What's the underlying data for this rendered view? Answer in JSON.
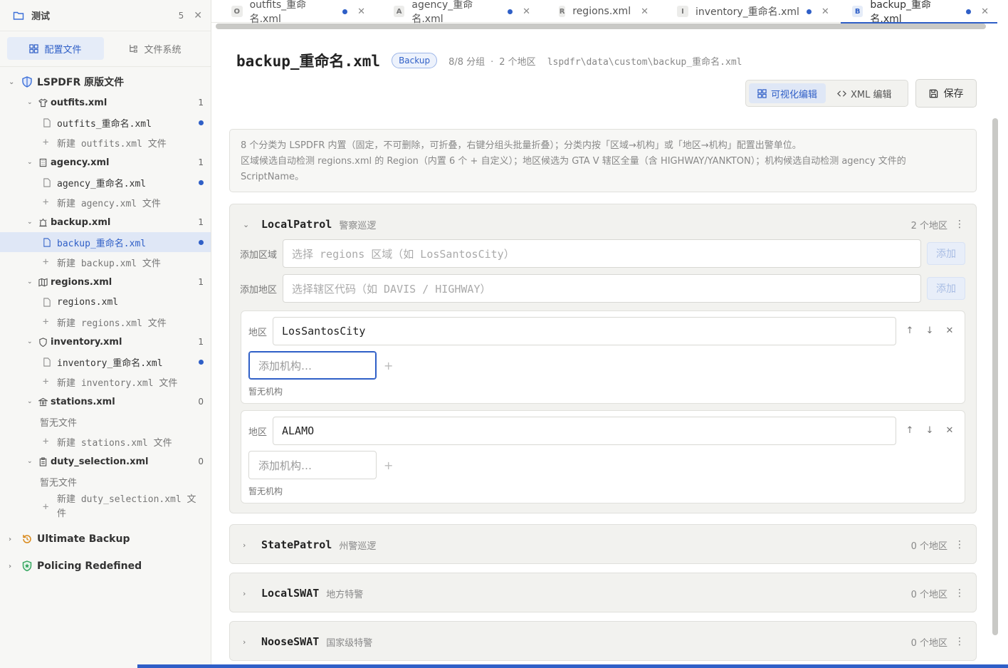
{
  "workspace": {
    "title": "测试",
    "count": "5",
    "close": "✕"
  },
  "sidebar_tabs": [
    {
      "label": "配置文件",
      "active": true
    },
    {
      "label": "文件系统",
      "active": false
    }
  ],
  "tree": {
    "roots": [
      {
        "label": "LSPDFR 原版文件",
        "icon": "shield-icon",
        "color": "#3b6fd8"
      },
      {
        "label": "Ultimate Backup",
        "icon": "backup-icon",
        "color": "#d98a1c"
      },
      {
        "label": "Policing Redefined",
        "icon": "badge-icon",
        "color": "#2fa35a"
      }
    ],
    "groups": [
      {
        "label": "outfits.xml",
        "count": "1",
        "icon": "shirt-icon",
        "file": "outfits_重命名.xml",
        "file_dot": true,
        "new": "新建 outfits.xml 文件"
      },
      {
        "label": "agency.xml",
        "count": "1",
        "icon": "building-icon",
        "file": "agency_重命名.xml",
        "file_dot": true,
        "new": "新建 agency.xml 文件"
      },
      {
        "label": "backup.xml",
        "count": "1",
        "icon": "siren-icon",
        "file": "backup_重命名.xml",
        "file_dot": true,
        "new": "新建 backup.xml 文件"
      },
      {
        "label": "regions.xml",
        "count": "1",
        "icon": "map-icon",
        "file": "regions.xml",
        "file_dot": false,
        "new": "新建 regions.xml 文件"
      },
      {
        "label": "inventory.xml",
        "count": "1",
        "icon": "shield-outline-icon",
        "file": "inventory_重命名.xml",
        "file_dot": true,
        "new": "新建 inventory.xml 文件"
      },
      {
        "label": "stations.xml",
        "count": "0",
        "icon": "station-icon",
        "empty": "暂无文件",
        "new": "新建 stations.xml 文件"
      },
      {
        "label": "duty_selection.xml",
        "count": "0",
        "icon": "clipboard-icon",
        "empty": "暂无文件",
        "new": "新建 duty_selection.xml 文件"
      }
    ]
  },
  "tabs": [
    {
      "letter": "O",
      "label": "outfits_重命名.xml",
      "dot": true
    },
    {
      "letter": "A",
      "label": "agency_重命名.xml",
      "dot": true
    },
    {
      "letter": "R",
      "label": "regions.xml",
      "dot": false
    },
    {
      "letter": "I",
      "label": "inventory_重命名.xml",
      "dot": true
    },
    {
      "letter": "B",
      "label": "backup_重命名.xml",
      "dot": true,
      "active": true
    }
  ],
  "file": {
    "title": "backup_重命名.xml",
    "badge": "Backup",
    "groups_meta": "8/8 分组",
    "areas_meta": "2 个地区",
    "sep": "·",
    "path": "lspdfr\\data\\custom\\backup_重命名.xml"
  },
  "modes": {
    "visual": "可视化编辑",
    "xml": "XML 编辑",
    "save": "保存"
  },
  "info": {
    "line1": "8 个分类为 LSPDFR 内置（固定，不可删除，可折叠，右键分组头批量折叠）；分类内按「区域→机构」或「地区→机构」配置出警单位。",
    "line2": "区域候选自动检测 regions.xml 的 Region（内置 6 个 + 自定义）；地区候选为 GTA V 辖区全量（含 HIGHWAY/YANKTON）；机构候选自动检测 agency 文件的",
    "line3": "ScriptName。"
  },
  "groups": [
    {
      "name": "LocalPatrol",
      "sub": "警察巡逻",
      "count": "2 个地区",
      "expanded": true,
      "add_region_label": "添加区域",
      "add_region_placeholder": "选择 regions 区域（如 LosSantosCity）",
      "add_area_label": "添加地区",
      "add_area_placeholder": "选择辖区代码（如 DAVIS / HIGHWAY）",
      "add_btn": "添加",
      "areas": [
        {
          "label": "地区",
          "value": "LosSantosCity",
          "agency_placeholder": "添加机构…",
          "empty": "暂无机构"
        },
        {
          "label": "地区",
          "value": "ALAMO",
          "agency_placeholder": "添加机构…",
          "empty": "暂无机构"
        }
      ]
    },
    {
      "name": "StatePatrol",
      "sub": "州警巡逻",
      "count": "0 个地区"
    },
    {
      "name": "LocalSWAT",
      "sub": "地方特警",
      "count": "0 个地区"
    },
    {
      "name": "NooseSWAT",
      "sub": "国家级特警",
      "count": "0 个地区"
    }
  ],
  "colors": {
    "accent": "#2f5fc7",
    "sidebar_bg": "#f7f7f5",
    "card_bg": "#f2f2ef"
  }
}
